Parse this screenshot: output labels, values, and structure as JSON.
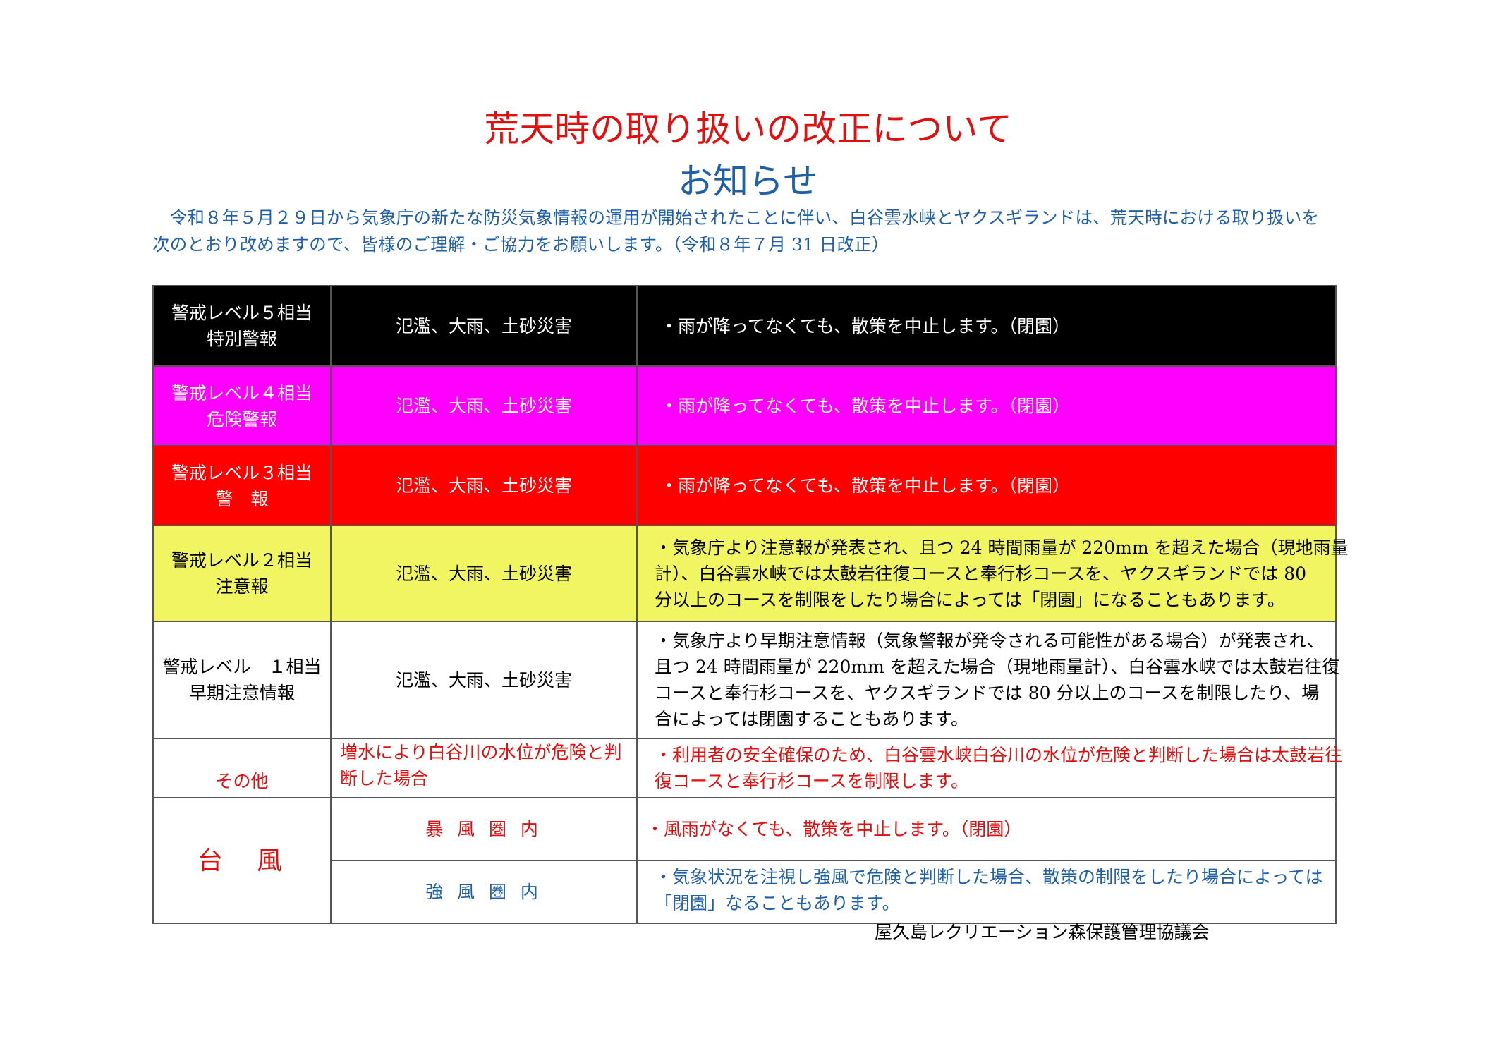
{
  "title": "荒天時の取り扱いの改正について",
  "subtitle": "お知らせ",
  "intro": [
    "　令和８年５月２９日から気象庁の新たな防災気象情報の運用が開始されたことに伴い、白谷雲水峡とヤクスギランドは、荒天時における取り扱いを",
    "次のとおり改めますので、皆様のご理解・ご協力をお願いします。（令和８年７月 31 日改正）"
  ],
  "rows": [
    {
      "level_line1": "警戒レベル５相当",
      "level_line2": "特別警報",
      "hazards": "氾濫、大雨、土砂災害",
      "action": "・雨が降ってなくても、散策を中止します。（閉園）",
      "color": "#000000"
    },
    {
      "level_line1": "警戒レベル４相当",
      "level_line2": "危険警報",
      "hazards": "氾濫、大雨、土砂災害",
      "action": "・雨が降ってなくても、散策を中止します。（閉園）",
      "color": "#ff00ff"
    },
    {
      "level_line1": "警戒レベル３相当",
      "level_line2": "警　報",
      "hazards": "氾濫、大雨、土砂災害",
      "action": "・雨が降ってなくても、散策を中止します。（閉園）",
      "color": "#ff0000"
    },
    {
      "level_line1": "警戒レベル２相当",
      "level_line2": "注意報",
      "hazards": "氾濫、大雨、土砂災害",
      "action_lines": [
        "・気象庁より注意報が発表され、且つ 24 時間雨量が 220mm を超えた場合（現地雨量",
        "計）、白谷雲水峡では太鼓岩往復コースと奉行杉コースを、ヤクスギランドでは 80",
        "分以上のコースを制限をしたり場合によっては「閉園」になることもあります。"
      ],
      "color": "#f2f562"
    },
    {
      "level_line1": "警戒レベル　１相当",
      "level_line2": "早期注意情報",
      "hazards": "氾濫、大雨、土砂災害",
      "action_lines": [
        "・気象庁より早期注意情報（気象警報が発令される可能性がある場合）が発表され、",
        "且つ 24 時間雨量が 220mm を超えた場合（現地雨量計）、白谷雲水峡では太鼓岩往復",
        "コースと奉行杉コースを、ヤクスギランドでは 80 分以上のコースを制限したり、場",
        "合によっては閉園することもあります。"
      ],
      "color": "#ffffff"
    }
  ],
  "other": {
    "label": "その他",
    "condition_lines": [
      "増水により白谷川の水位が危険と判",
      "断した場合"
    ],
    "action_lines": [
      "・利用者の安全確保のため、白谷雲水峡白谷川の水位が危険と判断した場合は太鼓岩往",
      "復コースと奉行杉コースを制限します。"
    ]
  },
  "typhoon": {
    "label": "台　風",
    "storm": {
      "zone": "暴 風 圏 内",
      "action": "・風雨がなくても、散策を中止します。（閉園）"
    },
    "strong_wind": {
      "zone": "強 風 圏 内",
      "action_lines": [
        "・気象状況を注視し強風で危険と判断した場合、散策の制限をしたり場合によっては",
        "「閉園」なることもあります。"
      ]
    }
  },
  "footer": "屋久島レクリエーション森保護管理協議会"
}
